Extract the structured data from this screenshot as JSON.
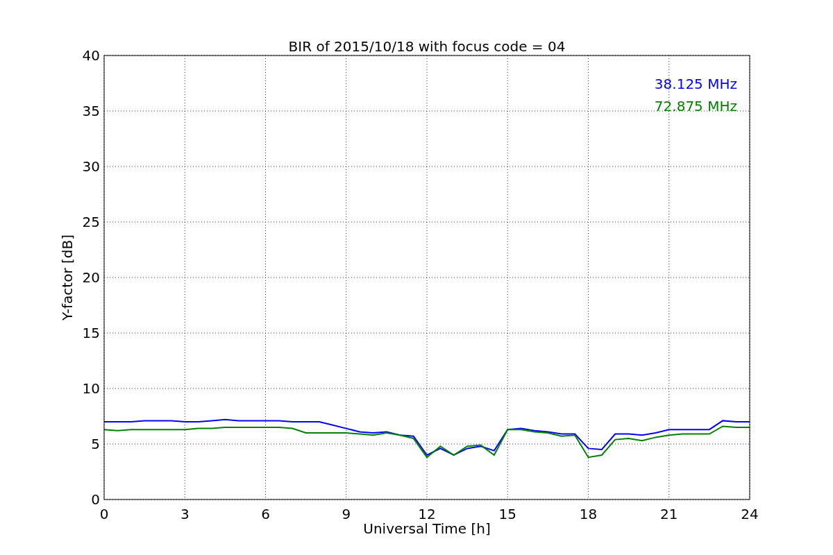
{
  "chart_data": {
    "type": "line",
    "title": "BIR of 2015/10/18 with focus code = 04",
    "xlabel": "Universal Time [h]",
    "ylabel": "Y-factor [dB]",
    "x": [
      0,
      0.5,
      1,
      1.5,
      2,
      2.5,
      3,
      3.5,
      4,
      4.5,
      5,
      5.5,
      6,
      6.5,
      7,
      7.5,
      8,
      8.5,
      9,
      9.5,
      10,
      10.5,
      11,
      11.5,
      12,
      12.5,
      13,
      13.5,
      14,
      14.5,
      15,
      15.5,
      16,
      16.5,
      17,
      17.5,
      18,
      18.5,
      19,
      19.5,
      20,
      20.5,
      21,
      21.5,
      22,
      22.5,
      23,
      23.5,
      24
    ],
    "series": [
      {
        "name": "38.125 MHz",
        "color": "#0000ff",
        "values": [
          7.0,
          7.0,
          7.0,
          7.1,
          7.1,
          7.1,
          7.0,
          7.0,
          7.1,
          7.2,
          7.1,
          7.1,
          7.1,
          7.1,
          7.0,
          7.0,
          7.0,
          6.7,
          6.4,
          6.1,
          6.0,
          6.1,
          5.8,
          5.7,
          4.0,
          4.6,
          4.0,
          4.6,
          4.8,
          4.4,
          6.3,
          6.4,
          6.2,
          6.1,
          5.9,
          5.9,
          4.6,
          4.5,
          5.9,
          5.9,
          5.8,
          6.0,
          6.3,
          6.3,
          6.3,
          6.3,
          7.1,
          7.0,
          7.0
        ]
      },
      {
        "name": "72.875 MHz",
        "color": "#008000",
        "values": [
          6.3,
          6.2,
          6.3,
          6.3,
          6.3,
          6.3,
          6.3,
          6.4,
          6.4,
          6.5,
          6.5,
          6.5,
          6.5,
          6.5,
          6.4,
          6.0,
          6.0,
          6.0,
          6.0,
          5.9,
          5.8,
          6.0,
          5.8,
          5.5,
          3.8,
          4.8,
          4.0,
          4.8,
          4.9,
          4.0,
          6.3,
          6.3,
          6.1,
          6.0,
          5.7,
          5.8,
          3.8,
          4.0,
          5.4,
          5.5,
          5.3,
          5.6,
          5.8,
          5.9,
          5.9,
          5.9,
          6.6,
          6.5,
          6.5
        ]
      }
    ],
    "xlim": [
      0,
      24
    ],
    "ylim": [
      0,
      40
    ],
    "xticks": [
      0,
      3,
      6,
      9,
      12,
      15,
      18,
      21,
      24
    ],
    "yticks": [
      0,
      5,
      10,
      15,
      20,
      25,
      30,
      35,
      40
    ],
    "grid": true
  }
}
